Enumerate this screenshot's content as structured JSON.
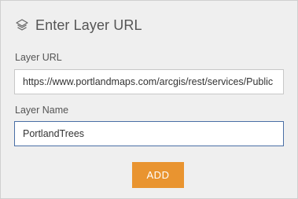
{
  "header": {
    "icon": "layers-icon",
    "title": "Enter Layer URL"
  },
  "form": {
    "url_label": "Layer URL",
    "url_value": "https://www.portlandmaps.com/arcgis/rest/services/Public",
    "name_label": "Layer Name",
    "name_value": "PortlandTrees"
  },
  "actions": {
    "add_label": "ADD"
  },
  "colors": {
    "accent": "#e99430",
    "focus_border": "#4a6fa5",
    "panel_background": "#efefef"
  }
}
